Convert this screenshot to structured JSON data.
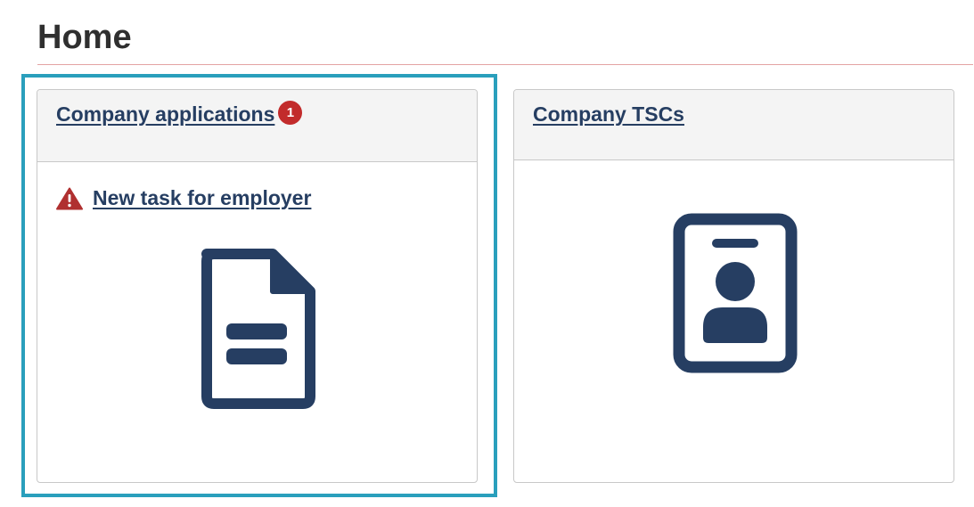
{
  "page": {
    "title": "Home"
  },
  "cards": [
    {
      "title": "Company applications",
      "badge_count": "1",
      "task_link": "New task for employer",
      "warning_icon": "warning-triangle-icon",
      "icon": "document-icon",
      "focused": true
    },
    {
      "title": "Company TSCs",
      "icon": "id-badge-icon",
      "focused": false
    }
  ],
  "colors": {
    "link": "#263e62",
    "icon": "#263e62",
    "badge": "#c22b2b",
    "warning": "#b03030",
    "focus_ring": "#2a9fbc",
    "title_rule": "#e3a3a3",
    "card_header_bg": "#f4f4f4"
  }
}
